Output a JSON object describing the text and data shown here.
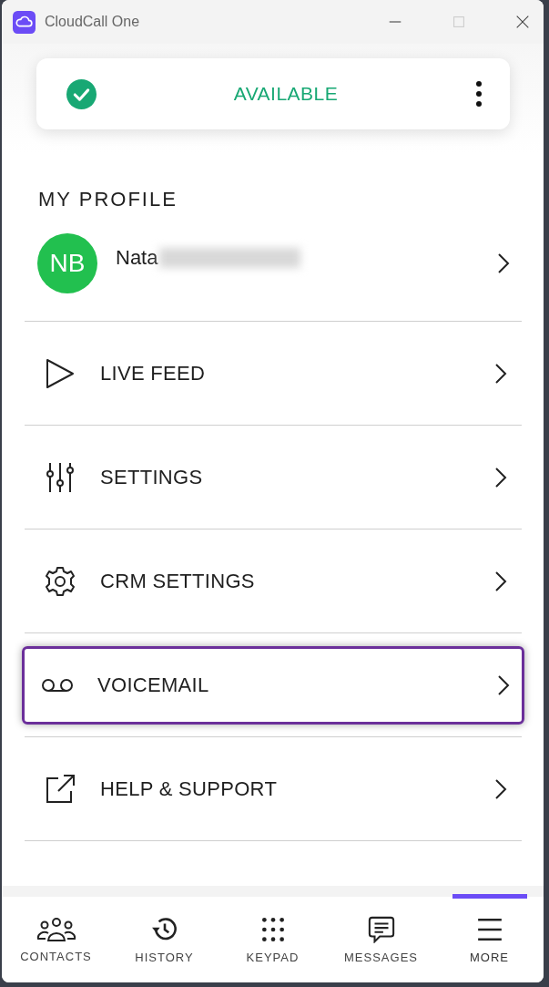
{
  "window": {
    "title": "CloudCall One"
  },
  "status": {
    "label": "AVAILABLE"
  },
  "section_title": "MY PROFILE",
  "profile": {
    "initials": "NB",
    "name": "Nata"
  },
  "menu": [
    {
      "label": "LIVE FEED",
      "highlighted": false
    },
    {
      "label": "SETTINGS",
      "highlighted": false
    },
    {
      "label": "CRM SETTINGS",
      "highlighted": false
    },
    {
      "label": "VOICEMAIL",
      "highlighted": true
    },
    {
      "label": "HELP & SUPPORT",
      "highlighted": false
    }
  ],
  "nav": [
    {
      "label": "CONTACTS",
      "selected": false
    },
    {
      "label": "HISTORY",
      "selected": false
    },
    {
      "label": "KEYPAD",
      "selected": false
    },
    {
      "label": "MESSAGES",
      "selected": false
    },
    {
      "label": "MORE",
      "selected": true
    }
  ]
}
